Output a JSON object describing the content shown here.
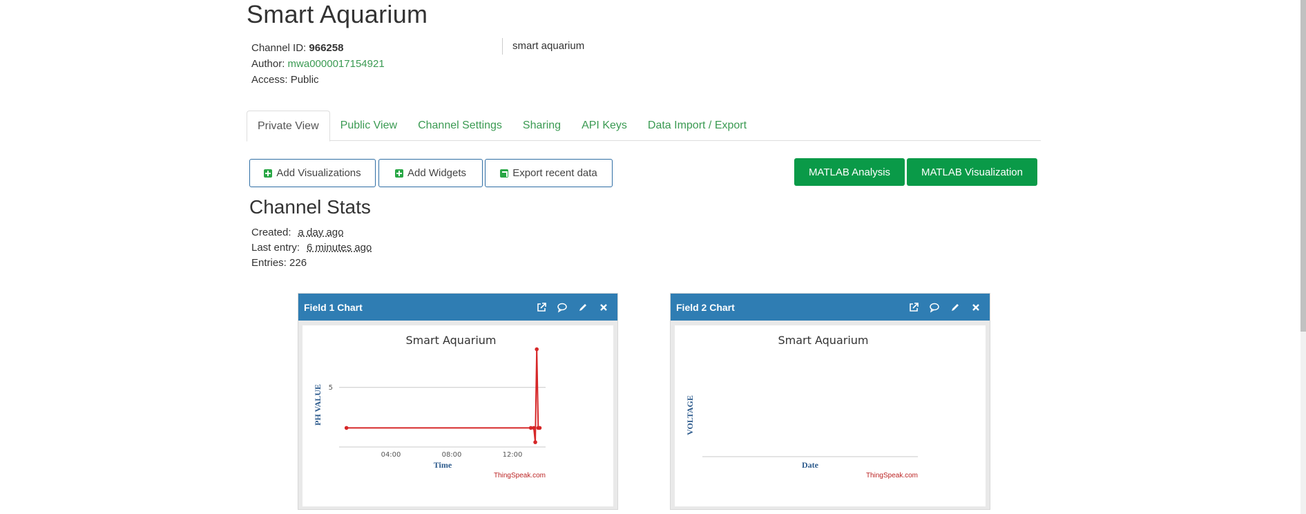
{
  "page": {
    "title": "Smart Aquarium",
    "channel_id_label": "Channel ID:",
    "channel_id": "966258",
    "author_label": "Author:",
    "author": "mwa0000017154921",
    "access_label": "Access:",
    "access": "Public",
    "description": "smart aquarium"
  },
  "tabs": [
    {
      "label": "Private View",
      "active": true
    },
    {
      "label": "Public View"
    },
    {
      "label": "Channel Settings"
    },
    {
      "label": "Sharing"
    },
    {
      "label": "API Keys"
    },
    {
      "label": "Data Import / Export"
    }
  ],
  "toolbar": {
    "add_visualizations": "Add Visualizations",
    "add_widgets": "Add Widgets",
    "export_recent": "Export recent data",
    "matlab_analysis": "MATLAB Analysis",
    "matlab_visualization": "MATLAB Visualization"
  },
  "stats": {
    "title": "Channel Stats",
    "created_label": "Created:",
    "created": "a day ago",
    "last_entry_label": "Last entry:",
    "last_entry": "6 minutes ago",
    "entries_label": "Entries:",
    "entries": "226"
  },
  "panels": [
    {
      "title": "Field 1 Chart",
      "credit": "ThingSpeak.com"
    },
    {
      "title": "Field 2 Chart",
      "credit": "ThingSpeak.com"
    }
  ],
  "colors": {
    "accent": "#3a9a52",
    "panel_header": "#2f7db3",
    "button_green": "#0a9a48",
    "series": "#d62728"
  },
  "chart_data": [
    {
      "type": "line",
      "title": "Smart Aquarium",
      "xlabel": "Time",
      "ylabel": "PH VALUE",
      "x_ticks": [
        "04:00",
        "08:00",
        "12:00"
      ],
      "y_ticks": [
        5
      ],
      "ylim": [
        0,
        8
      ],
      "series": [
        {
          "x": [
            0.5,
            13.0,
            13.2,
            13.3,
            13.4,
            13.5,
            13.6
          ],
          "y": [
            1.6,
            1.6,
            1.6,
            0.4,
            8.2,
            1.6,
            1.6
          ]
        }
      ]
    },
    {
      "type": "line",
      "title": "Smart Aquarium",
      "xlabel": "Date",
      "ylabel": "VOLTAGE",
      "series": []
    }
  ]
}
